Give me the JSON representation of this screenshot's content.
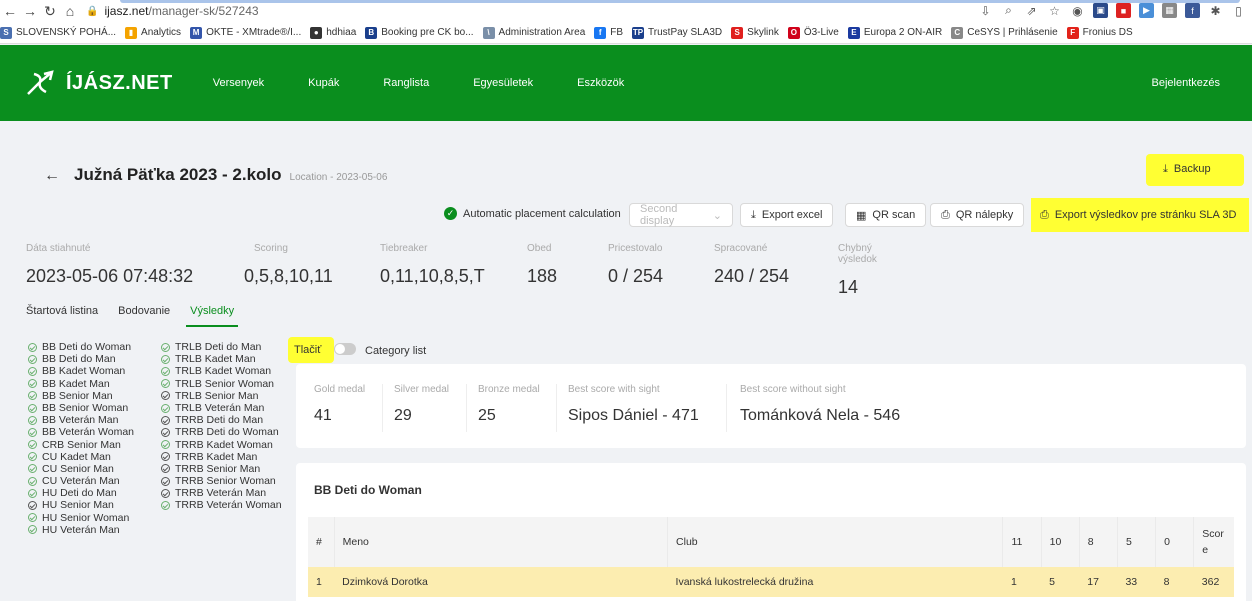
{
  "browser": {
    "url_host": "ijasz.net",
    "url_path": "/manager-sk/527243",
    "bookmarks": [
      {
        "label": "SLOVENSKÝ POHÁ...",
        "color": "#4a6fb0",
        "glyph": "S"
      },
      {
        "label": "Analytics",
        "color": "#f4a300",
        "glyph": "▮"
      },
      {
        "label": "OKTE - XMtrade®/I...",
        "color": "#3355aa",
        "glyph": "M"
      },
      {
        "label": "hdhiaa",
        "color": "#333333",
        "glyph": "●"
      },
      {
        "label": "Booking pre CK bo...",
        "color": "#1a3f8c",
        "glyph": "B"
      },
      {
        "label": "Administration Area",
        "color": "#7a8fa8",
        "glyph": "\\"
      },
      {
        "label": "FB",
        "color": "#1877f2",
        "glyph": "f"
      },
      {
        "label": "TrustPay SLA3D",
        "color": "#1a3f8c",
        "glyph": "TP"
      },
      {
        "label": "Skylink",
        "color": "#e0201e",
        "glyph": "S"
      },
      {
        "label": "Ö3-Live",
        "color": "#d0021b",
        "glyph": "O"
      },
      {
        "label": "Europa 2 ON-AIR",
        "color": "#1b3aa0",
        "glyph": "E"
      },
      {
        "label": "CeSYS | Prihlásenie",
        "color": "#888888",
        "glyph": "C"
      },
      {
        "label": "Fronius DS",
        "color": "#e2231a",
        "glyph": "F"
      }
    ]
  },
  "header": {
    "logo": "ÍJÁSZ.NET",
    "menu": [
      "Versenyek",
      "Kupák",
      "Ranglista",
      "Egyesületek",
      "Eszközök"
    ],
    "login": "Bejelentkezés"
  },
  "page": {
    "title": "Južná Päťka 2023 - 2.kolo",
    "subtitle": "Location - 2023-05-06",
    "backup": "Backup"
  },
  "toolbar": {
    "auto_placement": "Automatic placement calculation",
    "second_display": "Second display",
    "export_excel": "Export excel",
    "qr_scan": "QR scan",
    "qr_nalepky": "QR nálepky",
    "export_sla": "Export výsledkov pre stránku SLA 3D"
  },
  "stats": [
    {
      "label": "Dáta stiahnuté",
      "value": "2023-05-06 07:48:32"
    },
    {
      "label": "Scoring",
      "value": "0,5,8,10,11"
    },
    {
      "label": "Tiebreaker",
      "value": "0,11,10,8,5,T"
    },
    {
      "label": "Obed",
      "value": "188"
    },
    {
      "label": "Pricestovalo",
      "value": "0 / 254"
    },
    {
      "label": "Spracované",
      "value": "240 / 254"
    },
    {
      "label": "Chybný výsledok",
      "value": "14"
    }
  ],
  "tabs": [
    "Štartová listina",
    "Bodovanie",
    "Výsledky"
  ],
  "categories_col1": [
    "BB Deti do Woman",
    "BB Deti do Man",
    "BB Kadet Woman",
    "BB Kadet Man",
    "BB Senior Man",
    "BB Senior Woman",
    "BB Veterán Man",
    "BB Veterán Woman",
    "CRB Senior Man",
    "CU Kadet Man",
    "CU Senior Man",
    "CU Veterán Man",
    "HU Deti do Man",
    "HU Senior Man",
    "HU Senior Woman",
    "HU Veterán Man"
  ],
  "categories_col2": [
    "TRLB Deti do Man",
    "TRLB Kadet Man",
    "TRLB Kadet Woman",
    "TRLB Senior Woman",
    "TRLB Senior Man",
    "TRLB Veterán Man",
    "TRRB Deti do Man",
    "TRRB Deti do Woman",
    "TRRB Kadet Woman",
    "TRRB Kadet Man",
    "TRRB Senior Man",
    "TRRB Senior Woman",
    "TRRB Veterán Man",
    "TRRB Veterán Woman"
  ],
  "print": {
    "tlacit": "Tlačiť",
    "category_list": "Category list"
  },
  "medals": [
    {
      "label": "Gold medal",
      "value": "41"
    },
    {
      "label": "Silver medal",
      "value": "29"
    },
    {
      "label": "Bronze medal",
      "value": "25"
    },
    {
      "label": "Best score with sight",
      "value": "Sipos Dániel - 471"
    },
    {
      "label": "Best score without sight",
      "value": "Tománková Nela - 546"
    }
  ],
  "results": {
    "title": "BB Deti do Woman",
    "columns": [
      "#",
      "Meno",
      "Club",
      "11",
      "10",
      "8",
      "5",
      "0",
      "Score"
    ],
    "rows": [
      [
        "1",
        "Dzimková Dorotka",
        "Ivanská lukostrelecká družina",
        "1",
        "5",
        "17",
        "33",
        "8",
        "362"
      ]
    ]
  }
}
